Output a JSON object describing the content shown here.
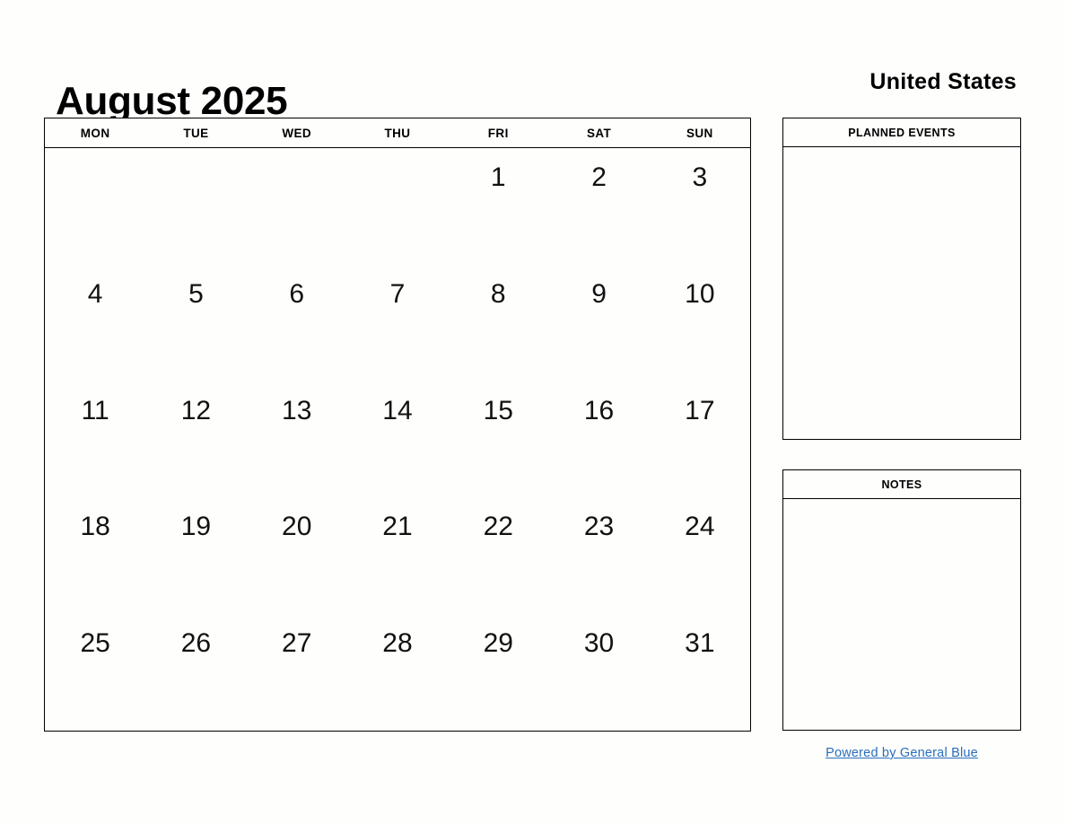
{
  "header": {
    "month_title": "August 2025",
    "country": "United States"
  },
  "calendar": {
    "weekdays": [
      "MON",
      "TUE",
      "WED",
      "THU",
      "FRI",
      "SAT",
      "SUN"
    ],
    "weeks": [
      [
        "",
        "",
        "",
        "",
        "1",
        "2",
        "3"
      ],
      [
        "4",
        "5",
        "6",
        "7",
        "8",
        "9",
        "10"
      ],
      [
        "11",
        "12",
        "13",
        "14",
        "15",
        "16",
        "17"
      ],
      [
        "18",
        "19",
        "20",
        "21",
        "22",
        "23",
        "24"
      ],
      [
        "25",
        "26",
        "27",
        "28",
        "29",
        "30",
        "31"
      ]
    ]
  },
  "panels": {
    "events_title": "PLANNED EVENTS",
    "events_content": "",
    "notes_title": "NOTES",
    "notes_content": ""
  },
  "footer": {
    "link_text": "Powered by General Blue",
    "link_color": "#2a6ebb"
  },
  "colors": {
    "background": "#fefefc",
    "border": "#000000",
    "text": "#000000",
    "link": "#2a6ebb"
  }
}
